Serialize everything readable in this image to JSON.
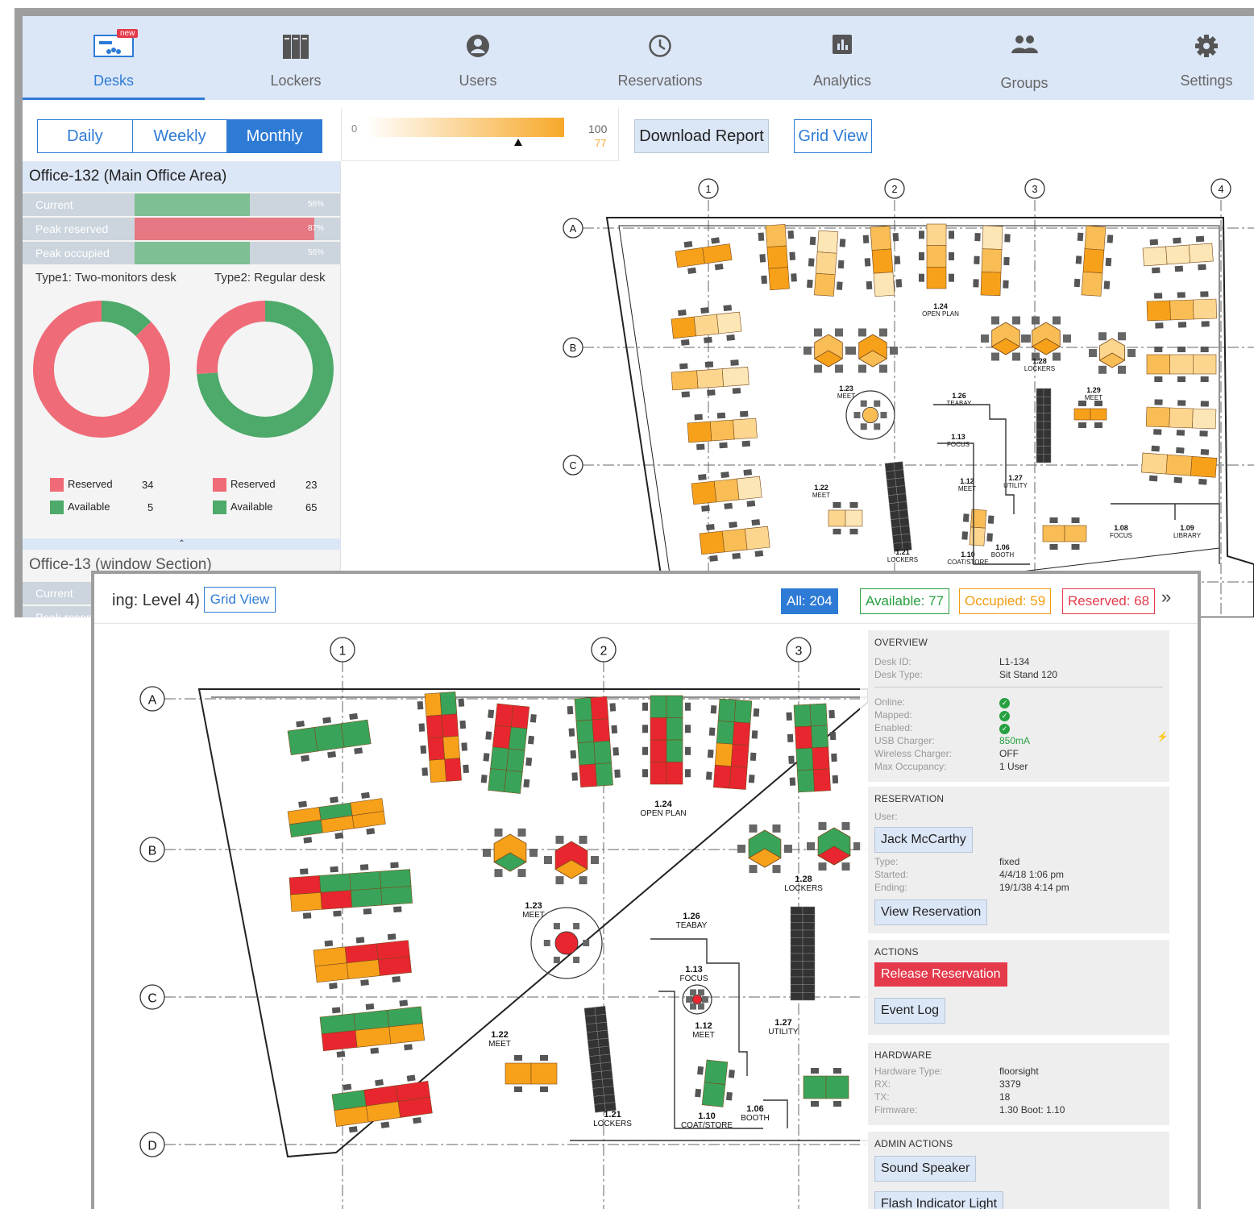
{
  "nav": {
    "items": [
      {
        "label": "Desks",
        "icon": "desk-monitor-icon",
        "badge": "new",
        "active": true
      },
      {
        "label": "Lockers",
        "icon": "lockers-icon"
      },
      {
        "label": "Users",
        "icon": "user-circle-icon"
      },
      {
        "label": "Reservations",
        "icon": "clock-icon"
      },
      {
        "label": "Analytics",
        "icon": "bar-chart-icon"
      },
      {
        "label": "Groups",
        "icon": "group-icon"
      },
      {
        "label": "Settings",
        "icon": "gear-icon"
      }
    ]
  },
  "period": {
    "options": [
      "Daily",
      "Weekly",
      "Monthly"
    ],
    "selected": "Monthly"
  },
  "occupancy_scale": {
    "min": "0",
    "max": "100",
    "value": "77",
    "value_num": 77,
    "color_low": "#ffffff",
    "color_high": "#f7a92a"
  },
  "toolbar": {
    "download": "Download Report",
    "grid_view": "Grid View"
  },
  "office1": {
    "title": "Office-132 (Main Office Area)",
    "bars": [
      {
        "label": "Current",
        "percent": "56%",
        "value": 0.56,
        "color": "#7fbf94"
      },
      {
        "label": "Peak reserved",
        "percent": "87%",
        "value": 0.87,
        "color": "#e57883"
      },
      {
        "label": "Peak occupied",
        "percent": "56%",
        "value": 0.56,
        "color": "#7fbf94"
      }
    ],
    "type1": {
      "label": "Type1: Two-monitors desk",
      "reserved_label": "Reserved",
      "reserved": "34",
      "available_label": "Available",
      "available": "5",
      "reserved_num": 34,
      "available_num": 5
    },
    "type2": {
      "label": "Type2: Regular desk",
      "reserved_label": "Reserved",
      "reserved": "23",
      "available_label": "Available",
      "available": "65",
      "reserved_num": 23,
      "available_num": 65
    },
    "colors": {
      "reserved": "#ef6b78",
      "available": "#4daa6a"
    }
  },
  "office2": {
    "title": "Office-13 (window Section)",
    "current": "Current",
    "peak_reserved": "Peak reserv"
  },
  "front": {
    "title": "ing: Level 4)",
    "grid_view": "Grid View",
    "counts": {
      "all": "All: 204",
      "available": "Available: 77",
      "occupied": "Occupied: 59",
      "reserved": "Reserved: 68"
    },
    "collapse": "»"
  },
  "overview": {
    "heading": "OVERVIEW",
    "desk_id_label": "Desk ID:",
    "desk_id": "L1-134",
    "desk_type_label": "Desk Type:",
    "desk_type": "Sit Stand 120",
    "online_label": "Online:",
    "mapped_label": "Mapped:",
    "enabled_label": "Enabled:",
    "usb_label": "USB Charger:",
    "usb": "850mA",
    "wireless_label": "Wireless Charger:",
    "wireless": "OFF",
    "maxocc_label": "Max Occupancy:",
    "maxocc": "1 User"
  },
  "reservation": {
    "heading": "RESERVATION",
    "user_label": "User:",
    "user": "Jack McCarthy",
    "type_label": "Type:",
    "type": "fixed",
    "started_label": "Started:",
    "started": "4/4/18 1:06 pm",
    "ending_label": "Ending:",
    "ending": "19/1/38 4:14 pm",
    "view_button": "View Reservation"
  },
  "actions": {
    "heading": "ACTIONS",
    "release": "Release Reservation",
    "event_log": "Event Log"
  },
  "hardware": {
    "heading": "HARDWARE",
    "type_label": "Hardware Type:",
    "type": "floorsight",
    "rx_label": "RX:",
    "rx": "3379",
    "tx_label": "TX:",
    "tx": "18",
    "fw_label": "Firmware:",
    "fw": "1.30 Boot: 1.10"
  },
  "admin": {
    "heading": "ADMIN ACTIONS",
    "sound": "Sound Speaker",
    "flash": "Flash Indicator Light"
  },
  "floorplan": {
    "columns": [
      "1",
      "2",
      "3",
      "4"
    ],
    "rows": [
      "A",
      "B",
      "C",
      "D"
    ],
    "rooms": [
      {
        "num": "1.24",
        "name": "OPEN PLAN"
      },
      {
        "num": "1.23",
        "name": "MEET"
      },
      {
        "num": "1.26",
        "name": "TEABAY"
      },
      {
        "num": "1.28",
        "name": "LOCKERS"
      },
      {
        "num": "1.29",
        "name": "MEET"
      },
      {
        "num": "1.13",
        "name": "FOCUS"
      },
      {
        "num": "1.12",
        "name": "MEET"
      },
      {
        "num": "1.27",
        "name": "UTILITY"
      },
      {
        "num": "1.22",
        "name": "MEET"
      },
      {
        "num": "1.21",
        "name": "LOCKERS"
      },
      {
        "num": "1.10",
        "name": "COAT/STORE"
      },
      {
        "num": "1.06",
        "name": "BOOTH"
      },
      {
        "num": "1.08",
        "name": "FOCUS"
      },
      {
        "num": "1.09",
        "name": "LIBRARY"
      }
    ],
    "desk_colors": {
      "available": "#3aa35a",
      "occupied": "#f7a11a",
      "reserved": "#e8262f",
      "locker": "#333333"
    }
  }
}
